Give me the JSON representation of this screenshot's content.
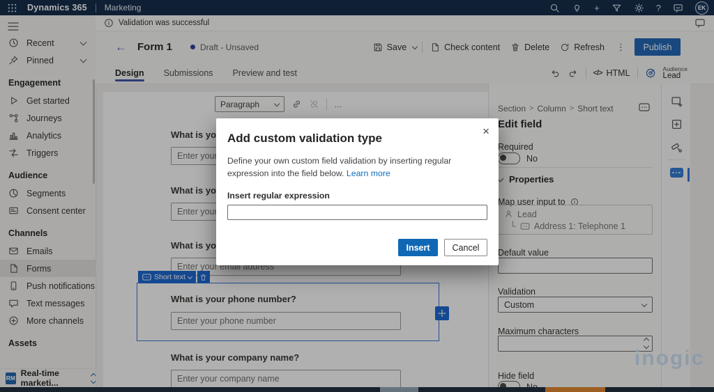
{
  "topbar": {
    "app_name": "Dynamics 365",
    "area_name": "Marketing",
    "plus_glyph": "+",
    "help_glyph": "?",
    "avatar_initials": "EK"
  },
  "notification": {
    "message": "Validation was successful"
  },
  "command_bar": {
    "back_glyph": "←",
    "title": "Form 1",
    "status": "Draft - Unsaved",
    "save_label": "Save",
    "check_content_label": "Check content",
    "delete_label": "Delete",
    "refresh_label": "Refresh",
    "more_glyph": "⋮",
    "publish_label": "Publish"
  },
  "tabs": {
    "items": [
      {
        "label": "Design"
      },
      {
        "label": "Submissions"
      },
      {
        "label": "Preview and test"
      }
    ],
    "code_glyph": "</>",
    "html_label": "HTML",
    "audience_label": "Audience",
    "audience_value": "Lead"
  },
  "editor_toolbar": {
    "style_selector": "Paragraph",
    "ellipsis": "…"
  },
  "canvas": {
    "fields": [
      {
        "label": "What is your name?",
        "placeholder": "Enter your name"
      },
      {
        "label": "What is your last name?",
        "placeholder": "Enter your last name"
      },
      {
        "label": "What is your email?",
        "placeholder": "Enter your email address"
      },
      {
        "label": "What is your phone number?",
        "placeholder": "Enter your phone number"
      },
      {
        "label": "What is your company name?",
        "placeholder": "Enter your company name"
      }
    ],
    "field_chip": {
      "label": "Short text"
    }
  },
  "modal": {
    "title": "Add custom validation type",
    "close_glyph": "×",
    "description": "Define your own custom field validation by inserting regular expression into the field below.",
    "learn_more": "Learn more",
    "input_label": "Insert regular expression",
    "insert_label": "Insert",
    "cancel_label": "Cancel"
  },
  "panel": {
    "breadcrumb": [
      "Section",
      "Column",
      "Short text"
    ],
    "breadcrumb_sep": ">",
    "title": "Edit field",
    "required_label": "Required",
    "required_value": "No",
    "properties_label": "Properties",
    "map_label": "Map user input to",
    "map_entity": "Lead",
    "map_connector": "└",
    "map_attribute": "Address 1: Telephone 1",
    "default_value_label": "Default value",
    "validation_label": "Validation",
    "validation_value": "Custom",
    "max_chars_label": "Maximum characters",
    "hide_field_label": "Hide field",
    "hide_field_value": "No"
  },
  "sidebar": {
    "recent": "Recent",
    "pinned": "Pinned",
    "sections": [
      {
        "title": "Engagement",
        "items": [
          "Get started",
          "Journeys",
          "Analytics",
          "Triggers"
        ]
      },
      {
        "title": "Audience",
        "items": [
          "Segments",
          "Consent center"
        ]
      },
      {
        "title": "Channels",
        "items": [
          "Emails",
          "Forms",
          "Push notifications",
          "Text messages",
          "More channels"
        ]
      },
      {
        "title": "Assets",
        "items": []
      }
    ],
    "area_switcher": {
      "badge": "RM",
      "label": "Real-time marketi..."
    }
  },
  "watermark": "inogic",
  "colors": {
    "accent": "#1765d0",
    "topbar": "#0f2847",
    "publish": "#1e63b4",
    "selection": "#2f6fce",
    "orange": "#e2862c"
  }
}
